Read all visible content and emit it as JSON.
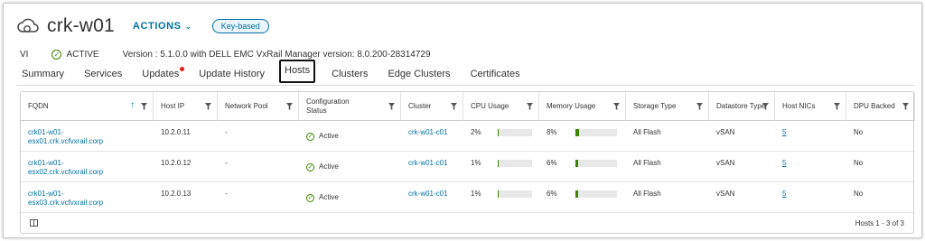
{
  "header": {
    "title": "crk-w01",
    "actions_label": "ACTIONS",
    "badge": "Key-based"
  },
  "status": {
    "type": "VI",
    "state": "ACTIVE",
    "version": "Version : 5.1.0.0 with DELL EMC VxRail Manager version: 8.0.200-28314729"
  },
  "tabs": [
    {
      "label": "Summary"
    },
    {
      "label": "Services"
    },
    {
      "label": "Updates",
      "notification": true
    },
    {
      "label": "Update History"
    },
    {
      "label": "Hosts",
      "selected": true
    },
    {
      "label": "Clusters"
    },
    {
      "label": "Edge Clusters"
    },
    {
      "label": "Certificates"
    }
  ],
  "table": {
    "columns": [
      "FQDN",
      "Host IP",
      "Network Pool",
      "Configuration Status",
      "Cluster",
      "CPU Usage",
      "Memory Usage",
      "Storage Type",
      "Datastore Type",
      "Host NICs",
      "DPU Backed"
    ],
    "sorted_column": "FQDN",
    "rows": [
      {
        "fqdn1": "crk01-w01-",
        "fqdn2": "esx01.crk.vcfvxrail.corp",
        "ip": "10.2.0.11",
        "pool": "-",
        "status": "Active",
        "cluster": "crk-w01-c01",
        "cpu": "2%",
        "cpu_frac": 0.02,
        "mem": "8%",
        "mem_frac": 0.08,
        "storage": "All Flash",
        "datastore": "vSAN",
        "nics": "5",
        "dpu": "No"
      },
      {
        "fqdn1": "crk01-w01-",
        "fqdn2": "esx02.crk.vcfvxrail.corp",
        "ip": "10.2.0.12",
        "pool": "-",
        "status": "Active",
        "cluster": "crk-w01-c01",
        "cpu": "1%",
        "cpu_frac": 0.01,
        "mem": "6%",
        "mem_frac": 0.06,
        "storage": "All Flash",
        "datastore": "vSAN",
        "nics": "5",
        "dpu": "No"
      },
      {
        "fqdn1": "crk01-w01-",
        "fqdn2": "esx03.crk.vcfvxrail.corp",
        "ip": "10.2.0.13",
        "pool": "-",
        "status": "Active",
        "cluster": "crk-w01-c01",
        "cpu": "1%",
        "cpu_frac": 0.01,
        "mem": "6%",
        "mem_frac": 0.06,
        "storage": "All Flash",
        "datastore": "vSAN",
        "nics": "5",
        "dpu": "No"
      }
    ],
    "footer": "Hosts 1 - 3 of 3"
  },
  "colors": {
    "link": "#0072a3",
    "success": "#3c8500",
    "notify": "#e02020"
  }
}
